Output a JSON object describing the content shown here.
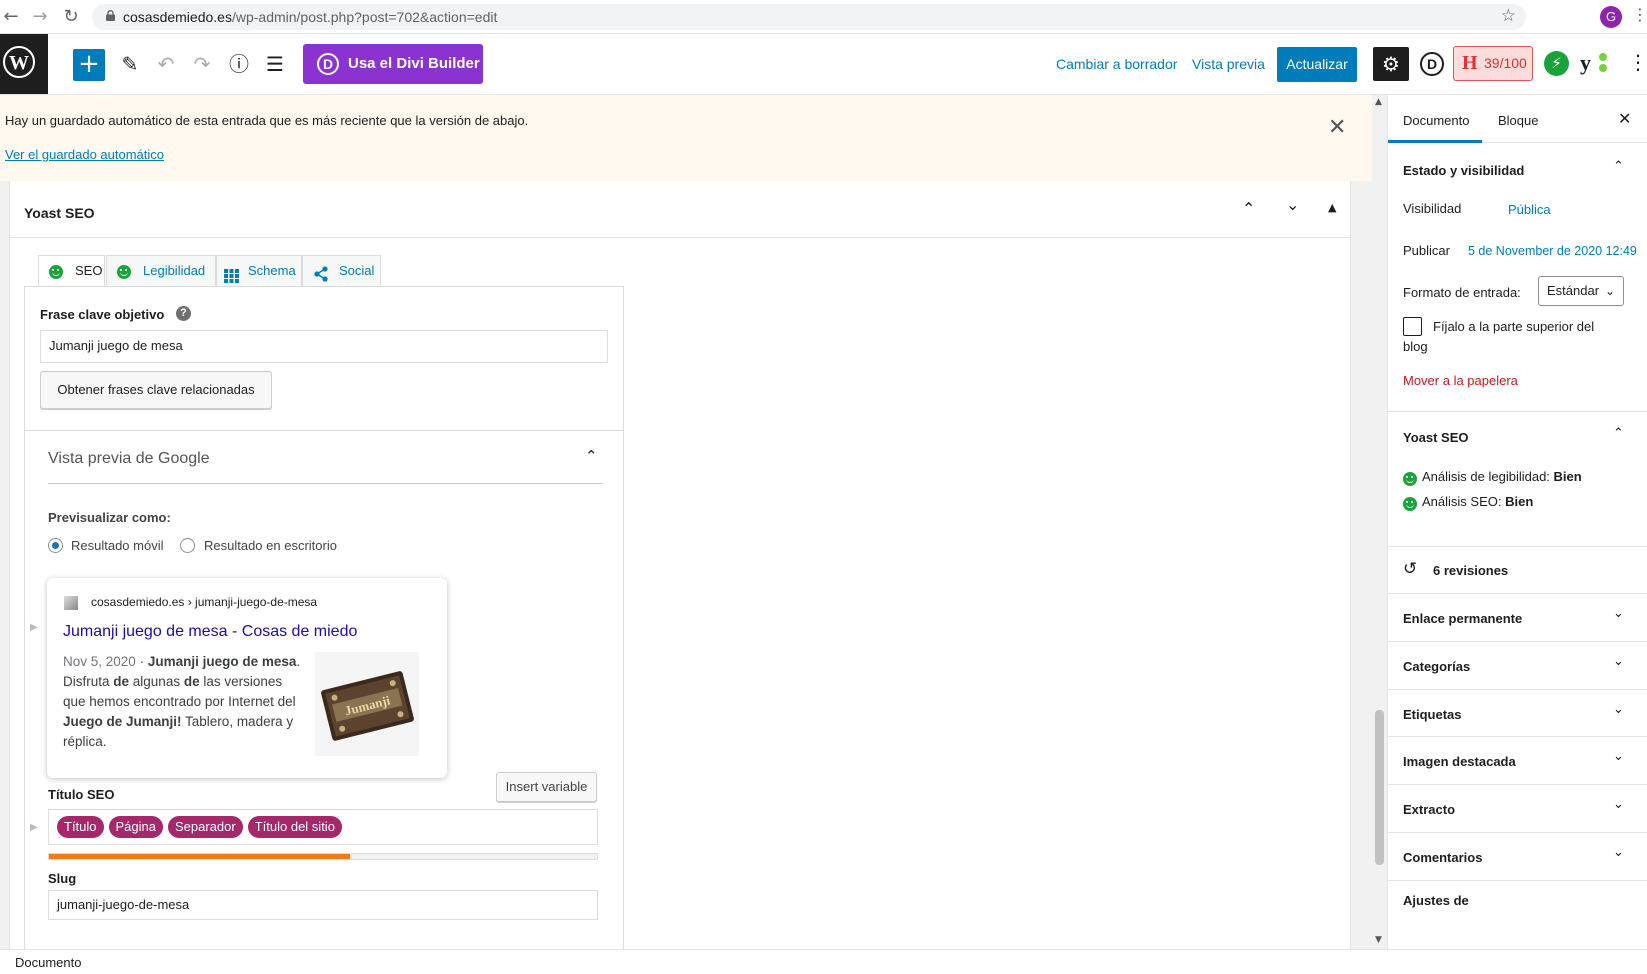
{
  "browser": {
    "url_domain": "cosasdemiedo.es",
    "url_path": "/wp-admin/post.php?post=702&action=edit",
    "profile_initial": "G"
  },
  "toolbar": {
    "divi_label": "Usa el Divi Builder",
    "draft_label": "Cambiar a borrador",
    "preview_label": "Vista previa",
    "update_label": "Actualizar",
    "seo_score": "39/100"
  },
  "notice": {
    "text": "Hay un guardado automático de esta entrada que es más reciente que la versión de abajo.",
    "link": "Ver el guardado automático"
  },
  "yoast": {
    "box_title": "Yoast SEO",
    "tabs": [
      "SEO",
      "Legibilidad",
      "Schema",
      "Social"
    ],
    "keyphrase_label": "Frase clave objetivo",
    "keyphrase_value": "Jumanji juego de mesa",
    "related_button": "Obtener frases clave relacionadas",
    "google_preview_title": "Vista previa de Google",
    "preview_as_label": "Previsualizar como:",
    "radio_mobile": "Resultado móvil",
    "radio_desktop": "Resultado en escritorio",
    "snippet": {
      "breadcrumb": "cosasdemiedo.es › jumanji-juego-de-mesa",
      "title": "Jumanji juego de mesa - Cosas de miedo",
      "date": "Nov 5, 2020",
      "desc_1_a": " · ",
      "desc_1_b": "Jumanji juego de mesa",
      "desc_1_c": ".",
      "desc_2_a": "Disfruta ",
      "desc_2_b": "de",
      "desc_2_c": " algunas ",
      "desc_2_d": "de",
      "desc_2_e": " las versiones",
      "desc_3": "que hemos encontrado por Internet del",
      "desc_4_a": "Juego de Jumanji!",
      "desc_4_b": " Tablero, madera y",
      "desc_5": "réplica.",
      "image_text": "Jumanji"
    },
    "seo_title_label": "Título SEO",
    "insert_variable": "Insert variable",
    "title_pills": [
      "Título",
      "Página",
      "Separador",
      "Título del sitio"
    ],
    "title_progress": 0.55,
    "slug_label": "Slug",
    "slug_value": "jumanji-juego-de-mesa"
  },
  "sidebar": {
    "tab_document": "Documento",
    "tab_block": "Bloque",
    "status_title": "Estado y visibilidad",
    "visibility_label": "Visibilidad",
    "visibility_value": "Pública",
    "publish_label": "Publicar",
    "publish_value": "5 de November de 2020 12:49",
    "format_label": "Formato de entrada:",
    "format_value": "Estándar",
    "sticky_label_1": "Fíjalo a la parte superior del",
    "sticky_label_2": "blog",
    "trash_link": "Mover a la papelera",
    "yoast_title": "Yoast SEO",
    "readability_label": "Análisis de legibilidad: ",
    "readability_value": "Bien",
    "seo_label": "Análisis SEO: ",
    "seo_value": "Bien",
    "revisions": "6 revisiones",
    "sections": [
      "Enlace permanente",
      "Categorías",
      "Etiquetas",
      "Imagen destacada",
      "Extracto",
      "Comentarios",
      "Ajustes de"
    ]
  },
  "statusbar": {
    "label": "Documento"
  },
  "colors": {
    "wp_blue": "#007cba",
    "divi_purple": "#8a33d1",
    "yoast_pill": "#a4286a",
    "good_green": "#1aa33a",
    "progress_orange": "#ee7c1b"
  }
}
